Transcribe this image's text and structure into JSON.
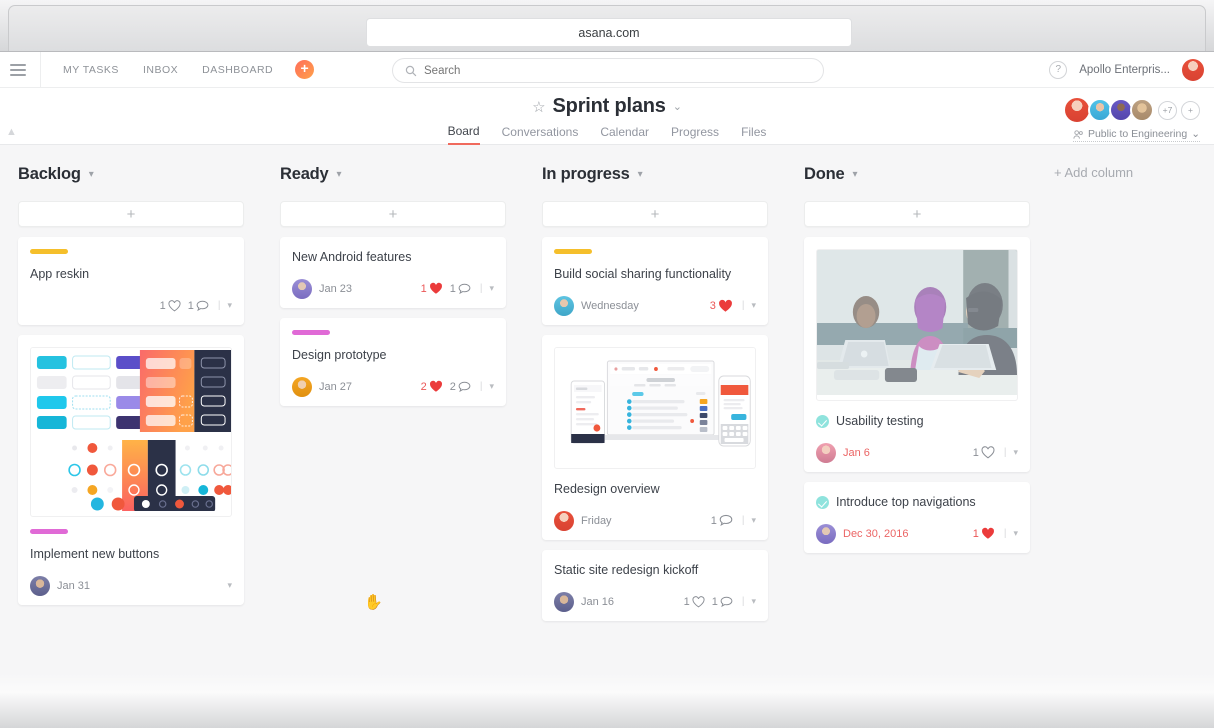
{
  "browser": {
    "url": "asana.com"
  },
  "topnav": {
    "menu_icon": "hamburger-icon",
    "links": [
      "MY TASKS",
      "INBOX",
      "DASHBOARD"
    ],
    "add_label": "+",
    "search_placeholder": "Search",
    "help_label": "?",
    "workspace": "Apollo Enterpris..."
  },
  "project": {
    "star": "☆",
    "title": "Sprint plans",
    "caret": "⌄",
    "tabs": [
      {
        "label": "Board",
        "active": true
      },
      {
        "label": "Conversations",
        "active": false
      },
      {
        "label": "Calendar",
        "active": false
      },
      {
        "label": "Progress",
        "active": false
      },
      {
        "label": "Files",
        "active": false
      }
    ],
    "member_overflow": "+7",
    "member_add": "+",
    "privacy": "Public to Engineering",
    "privacy_caret": "⌄"
  },
  "board": {
    "add_column_label": "+ Add column",
    "add_card_label": "+",
    "columns": [
      {
        "title": "Backlog",
        "cards": [
          {
            "title": "App reskin",
            "tag_color": "#f5bf2b",
            "assignee": null,
            "due": null,
            "likes": "1",
            "liked": false,
            "comments": "1",
            "thumb": null,
            "completed": false
          },
          {
            "title": "Implement new buttons",
            "tag_color": "#e06ad6",
            "assignee": "av-dark",
            "due": "Jan 31",
            "likes": null,
            "liked": false,
            "comments": null,
            "thumb": "design-system",
            "completed": false
          }
        ]
      },
      {
        "title": "Ready",
        "cards": [
          {
            "title": "New Android features",
            "tag_color": null,
            "assignee": "av-violet",
            "due": "Jan 23",
            "likes": "1",
            "liked": true,
            "comments": "1",
            "thumb": null,
            "completed": false
          },
          {
            "title": "Design prototype",
            "tag_color": "#e06ad6",
            "assignee": "av-orange",
            "due": "Jan 27",
            "likes": "2",
            "liked": true,
            "comments": "2",
            "thumb": null,
            "completed": false
          }
        ]
      },
      {
        "title": "In progress",
        "cards": [
          {
            "title": "Build social sharing functionality",
            "tag_color": "#f5bf2b",
            "assignee": "av-skyb",
            "due": "Wednesday",
            "likes": "3",
            "liked": true,
            "comments": null,
            "thumb": null,
            "completed": false
          },
          {
            "title": "Redesign overview",
            "tag_color": null,
            "assignee": "av-red",
            "due": "Friday",
            "likes": null,
            "liked": false,
            "comments": "1",
            "thumb": "devices",
            "completed": false
          },
          {
            "title": "Static site redesign kickoff",
            "tag_color": null,
            "assignee": "av-dark",
            "due": "Jan 16",
            "likes": "1",
            "liked": false,
            "comments": "1",
            "thumb": null,
            "completed": false
          }
        ]
      },
      {
        "title": "Done",
        "cards": [
          {
            "title": "Usability testing",
            "tag_color": null,
            "assignee": "av-pink",
            "due": "Jan 6",
            "due_overdue": true,
            "likes": "1",
            "liked": false,
            "comments": null,
            "thumb": "meeting-photo",
            "completed": true
          },
          {
            "title": "Introduce top navigations",
            "tag_color": null,
            "assignee": "av-violet",
            "due": "Dec 30, 2016",
            "due_overdue": true,
            "likes": "1",
            "liked": true,
            "comments": null,
            "thumb": null,
            "completed": true
          }
        ]
      }
    ]
  },
  "colors": {
    "accent": "#f06a5d",
    "tag_yellow": "#f5bf2b",
    "tag_magenta": "#e06ad6",
    "done_check": "#8fe3dd",
    "like_red": "#eb5757",
    "overdue": "#eb6565"
  }
}
